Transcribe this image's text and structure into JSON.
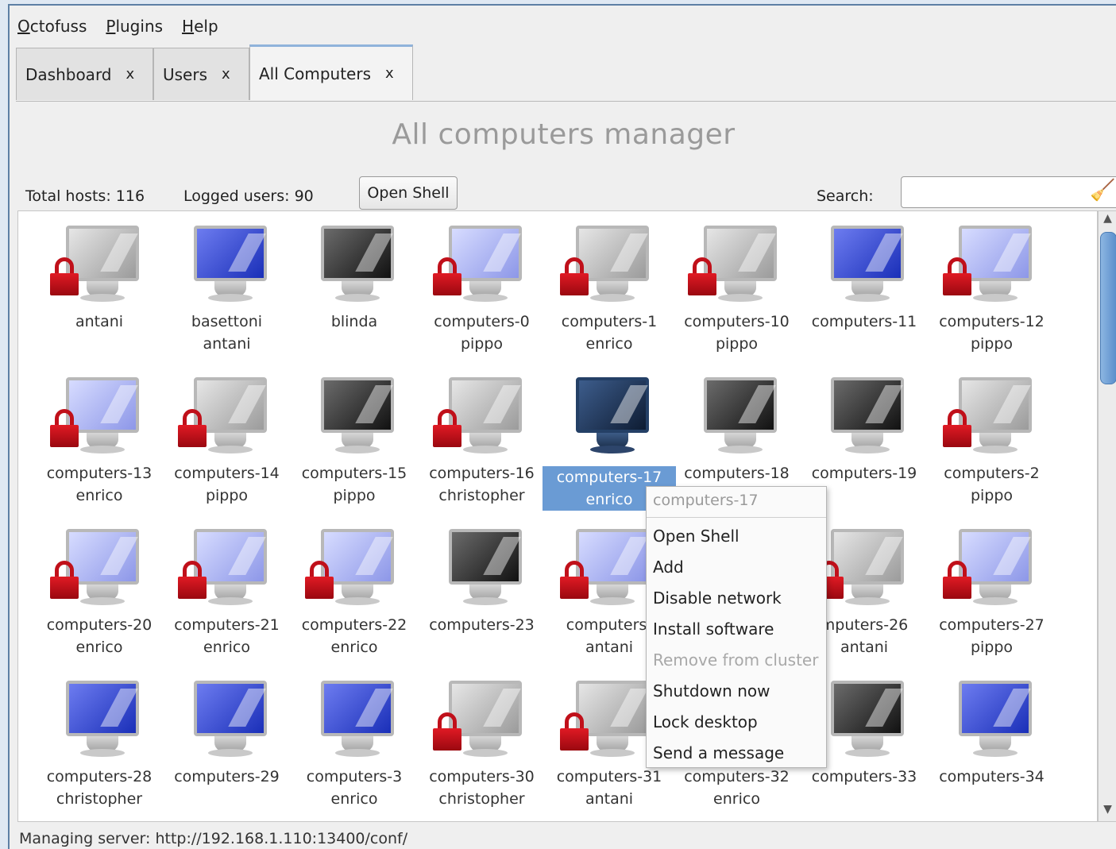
{
  "menu": {
    "items": [
      {
        "label": "Octofuss",
        "mnemonic": "O",
        "rest": "ctofuss"
      },
      {
        "label": "Plugins",
        "mnemonic": "P",
        "rest": "lugins"
      },
      {
        "label": "Help",
        "mnemonic": "H",
        "rest": "elp"
      }
    ]
  },
  "tabs": [
    {
      "label": "Dashboard",
      "close": "x"
    },
    {
      "label": "Users",
      "close": "x"
    },
    {
      "label": "All Computers",
      "close": "x",
      "active": true
    }
  ],
  "page": {
    "title": "All computers manager",
    "total_hosts": "Total hosts: 116",
    "logged_users": "Logged users: 90",
    "open_shell_label": "Open Shell",
    "search_label": "Search:",
    "search_value": ""
  },
  "computers": [
    {
      "name": "antani",
      "user": "",
      "color": "gray",
      "locked": true
    },
    {
      "name": "basettoni",
      "user": "antani",
      "color": "blue",
      "locked": false
    },
    {
      "name": "blinda",
      "user": "",
      "color": "black",
      "locked": false
    },
    {
      "name": "computers-0",
      "user": "pippo",
      "color": "light",
      "locked": true
    },
    {
      "name": "computers-1",
      "user": "enrico",
      "color": "gray",
      "locked": true
    },
    {
      "name": "computers-10",
      "user": "pippo",
      "color": "gray",
      "locked": true
    },
    {
      "name": "computers-11",
      "user": "",
      "color": "blue",
      "locked": false
    },
    {
      "name": "computers-12",
      "user": "pippo",
      "color": "light",
      "locked": true
    },
    {
      "name": "computers-13",
      "user": "enrico",
      "color": "light",
      "locked": true
    },
    {
      "name": "computers-14",
      "user": "pippo",
      "color": "gray",
      "locked": true
    },
    {
      "name": "computers-15",
      "user": "pippo",
      "color": "black",
      "locked": false
    },
    {
      "name": "computers-16",
      "user": "christopher",
      "color": "gray",
      "locked": true
    },
    {
      "name": "computers-17",
      "user": "enrico",
      "color": "navy",
      "locked": false,
      "selected": true
    },
    {
      "name": "computers-18",
      "user": "",
      "color": "black",
      "locked": false
    },
    {
      "name": "computers-19",
      "user": "",
      "color": "black",
      "locked": false
    },
    {
      "name": "computers-2",
      "user": "pippo",
      "color": "gray",
      "locked": true
    },
    {
      "name": "computers-20",
      "user": "enrico",
      "color": "light",
      "locked": true
    },
    {
      "name": "computers-21",
      "user": "enrico",
      "color": "light",
      "locked": true
    },
    {
      "name": "computers-22",
      "user": "enrico",
      "color": "light",
      "locked": true
    },
    {
      "name": "computers-23",
      "user": "",
      "color": "black",
      "locked": false
    },
    {
      "name": "computers-",
      "user": "antani",
      "color": "light",
      "locked": true
    },
    {
      "name": "",
      "user": "",
      "color": "gray",
      "locked": true
    },
    {
      "name": "mputers-26",
      "user": "antani",
      "color": "gray",
      "locked": true
    },
    {
      "name": "computers-27",
      "user": "pippo",
      "color": "light",
      "locked": true
    },
    {
      "name": "computers-28",
      "user": "christopher",
      "color": "blue",
      "locked": false
    },
    {
      "name": "computers-29",
      "user": "",
      "color": "blue",
      "locked": false
    },
    {
      "name": "computers-3",
      "user": "enrico",
      "color": "blue",
      "locked": false
    },
    {
      "name": "computers-30",
      "user": "christopher",
      "color": "gray",
      "locked": true
    },
    {
      "name": "computers-31",
      "user": "antani",
      "color": "gray",
      "locked": true
    },
    {
      "name": "computers-32",
      "user": "enrico",
      "color": "black",
      "locked": false
    },
    {
      "name": "computers-33",
      "user": "",
      "color": "black",
      "locked": false
    },
    {
      "name": "computers-34",
      "user": "",
      "color": "blue",
      "locked": false
    }
  ],
  "context_menu": {
    "title": "computers-17",
    "items": [
      {
        "label": "Open Shell",
        "enabled": true
      },
      {
        "label": "Add",
        "enabled": true
      },
      {
        "label": "Disable network",
        "enabled": true
      },
      {
        "label": "Install software",
        "enabled": true
      },
      {
        "label": "Remove from cluster",
        "enabled": false
      },
      {
        "label": "Shutdown now",
        "enabled": true
      },
      {
        "label": "Lock desktop",
        "enabled": true
      },
      {
        "label": "Send a message",
        "enabled": true
      }
    ]
  },
  "status": {
    "text": "Managing server: http://192.168.1.110:13400/conf/"
  },
  "colors": {
    "selection": "#6a9bd4",
    "lock_red": "#c0101a",
    "heading_gray": "#9a9a9a"
  }
}
